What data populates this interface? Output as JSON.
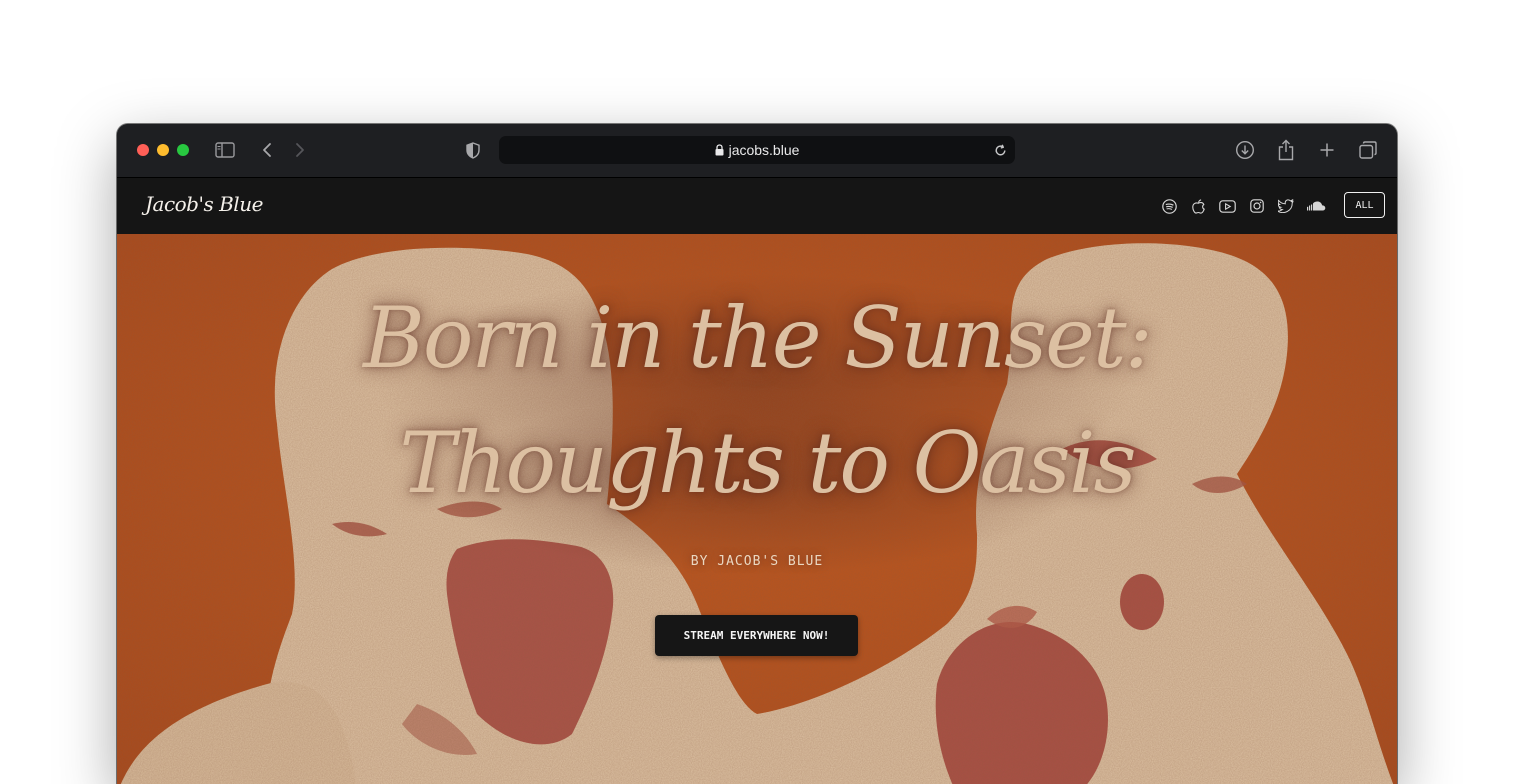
{
  "browser": {
    "url": "jacobs.blue",
    "traffic_lights": {
      "close": "#ff5f57",
      "minimize": "#febc2e",
      "zoom": "#28c840"
    }
  },
  "site": {
    "logo": "Jacob's Blue",
    "nav": {
      "social_icons": [
        "spotify-icon",
        "apple-icon",
        "youtube-icon",
        "instagram-icon",
        "twitter-icon",
        "soundcloud-icon"
      ],
      "all_label": "ALL"
    }
  },
  "hero": {
    "title_line1": "Born in  the Sunset:",
    "title_line2": "Thoughts to Oasis",
    "byline": "BY JACOB'S BLUE",
    "cta_label": "STREAM EVERYWHERE NOW!",
    "colors": {
      "background": "#b8521b",
      "figure": "#dcc1a2",
      "accent": "#a3423a"
    }
  }
}
